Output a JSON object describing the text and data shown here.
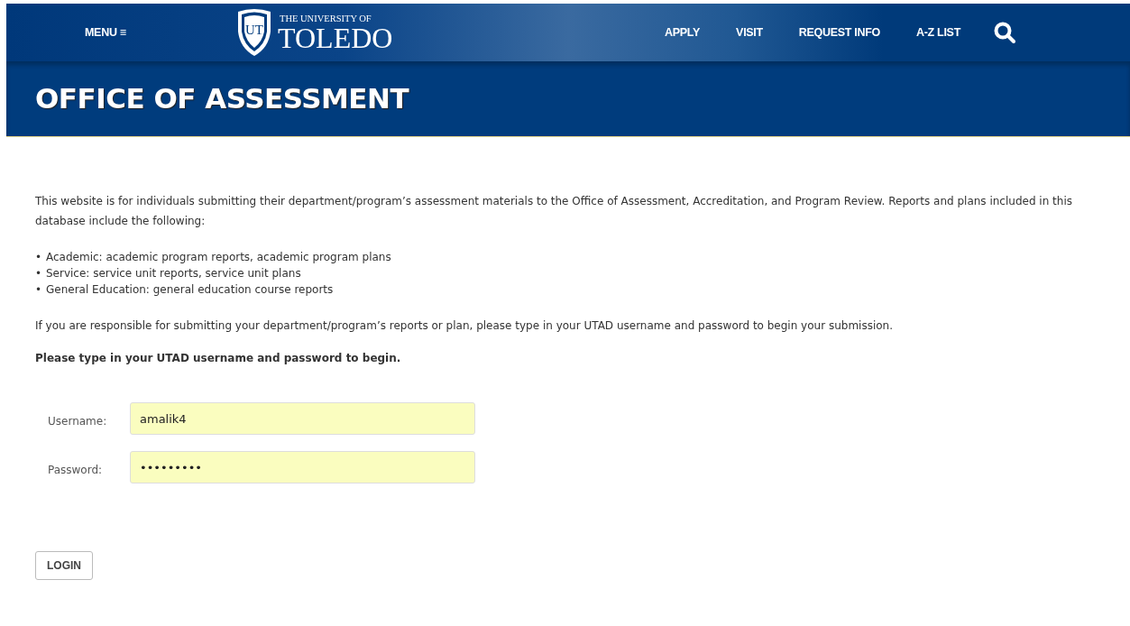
{
  "header": {
    "menu": "MENU ≡",
    "logo": {
      "mark": "UT",
      "line1": "THE UNIVERSITY OF",
      "line2": "TOLEDO"
    },
    "nav": [
      "APPLY",
      "VISIT",
      "REQUEST INFO",
      "A-Z LIST"
    ]
  },
  "page_title": "OFFICE OF ASSESSMENT",
  "intro": "This website is for individuals submitting their department/program’s assessment materials to the Office of Assessment, Accreditation, and Program Review. Reports and plans included in this database include the following:",
  "list": [
    {
      "marker": "•",
      "text": "Academic: academic program reports, academic program plans"
    },
    {
      "marker": "•",
      "text": "Service: service unit reports, service unit plans"
    },
    {
      "marker": "•",
      "text": "General Education: general education course reports"
    }
  ],
  "instruction": "If you are responsible for submitting your department/program’s reports or plan, please type in your UTAD username and password to begin your submission.",
  "prompt": "Please type in your UTAD username and password to begin.",
  "fields": [
    {
      "label": "Username:",
      "value": "amalik4"
    },
    {
      "label": "Password:",
      "value": "•••••••••"
    }
  ],
  "button": "LOGIN"
}
